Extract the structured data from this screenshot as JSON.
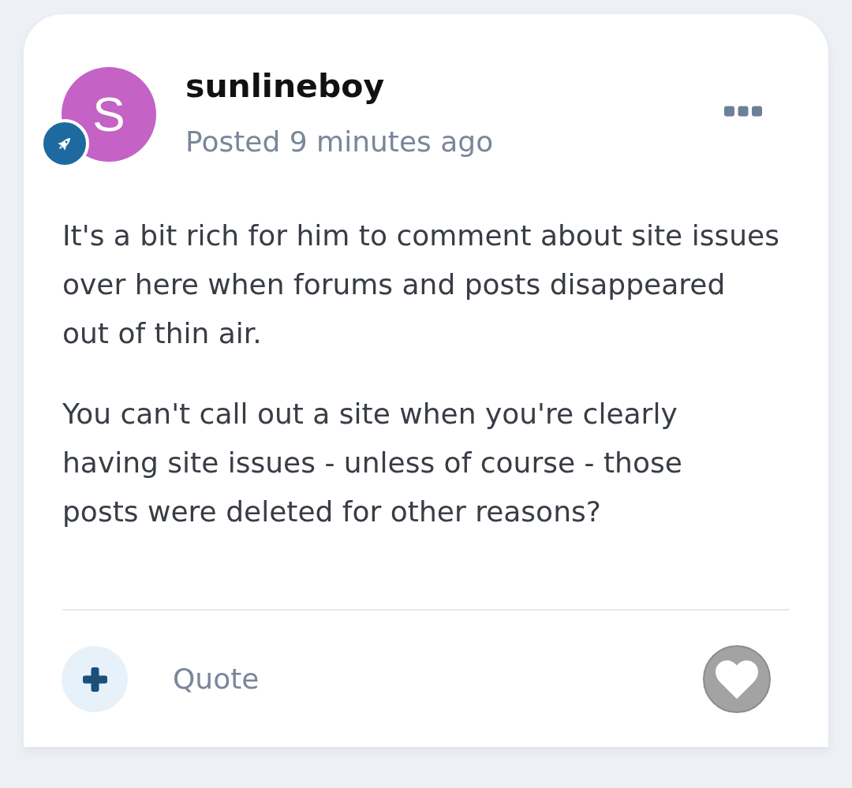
{
  "post": {
    "author": {
      "name": "sunlineboy",
      "avatar_initial": "S"
    },
    "posted": "Posted 9 minutes ago",
    "paragraphs": [
      {
        "lines": [
          "It's a bit rich for him to comment about site issues",
          "over here when forums and posts disappeared",
          "out of thin air."
        ]
      },
      {
        "lines": [
          "You can't call out a site when you're clearly",
          "having site issues - unless of course - those",
          "posts were deleted for other reasons?"
        ]
      }
    ]
  },
  "actions": {
    "quote": "Quote"
  }
}
